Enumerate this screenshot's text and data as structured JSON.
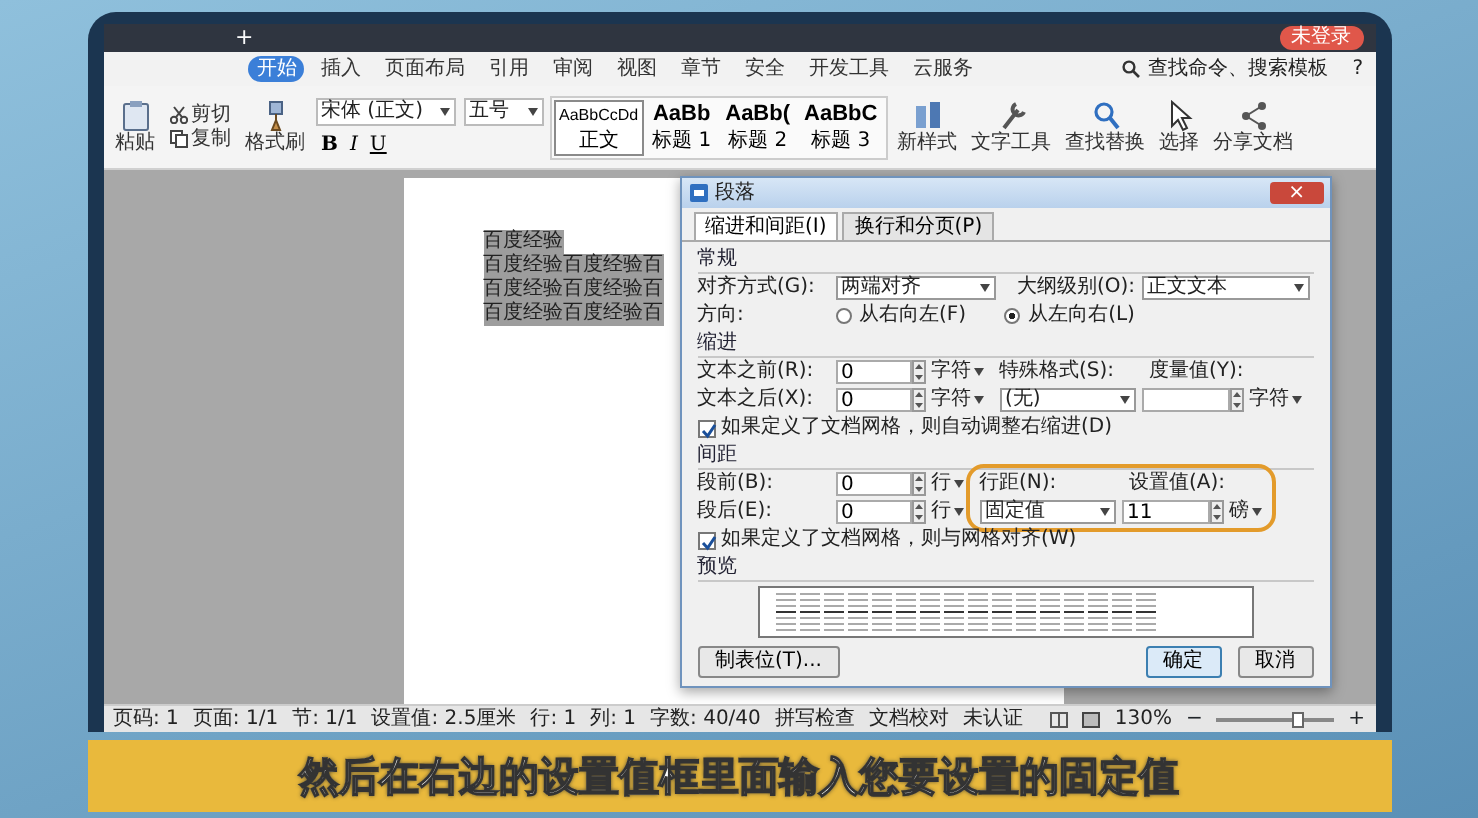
{
  "window": {
    "new_tab": "+",
    "account": "未登录"
  },
  "ribbon": {
    "tabs": [
      {
        "label": "开始",
        "selected": true
      },
      {
        "label": "插入",
        "selected": false
      },
      {
        "label": "页面布局",
        "selected": false
      },
      {
        "label": "引用",
        "selected": false
      },
      {
        "label": "审阅",
        "selected": false
      },
      {
        "label": "视图",
        "selected": false
      },
      {
        "label": "章节",
        "selected": false
      },
      {
        "label": "安全",
        "selected": false
      },
      {
        "label": "开发工具",
        "selected": false
      },
      {
        "label": "云服务",
        "selected": false
      }
    ],
    "search": "查找命令、搜索模板",
    "help": "?"
  },
  "toolbar": {
    "paste": "粘贴",
    "cut": "剪切",
    "copy": "复制",
    "format_painter": "格式刷",
    "font": "宋体 (正文)",
    "size": "五号",
    "format_buttons": [
      "B",
      "I",
      "U"
    ],
    "styles": [
      {
        "sample": "AaBbCcDd",
        "label": "正文",
        "selected": true
      },
      {
        "sample": "AaBb",
        "label": "标题 1",
        "selected": false
      },
      {
        "sample": "AaBb(",
        "label": "标题 2",
        "selected": false
      },
      {
        "sample": "AaBbC",
        "label": "标题 3",
        "selected": false
      }
    ],
    "tools": [
      {
        "label": "新样式",
        "kind": "styles"
      },
      {
        "label": "文字工具",
        "kind": "text"
      },
      {
        "label": "查找替换",
        "kind": "search"
      },
      {
        "label": "选择",
        "kind": "select"
      },
      {
        "label": "分享文档",
        "kind": "share"
      }
    ]
  },
  "document": {
    "lines": [
      "百度经验",
      "百度经验百度经验百",
      "百度经验百度经验百",
      "百度经验百度经验百"
    ]
  },
  "dialog": {
    "title": "段落",
    "close": "×",
    "tabs": [
      {
        "label": "缩进和间距(I)",
        "selected": true
      },
      {
        "label": "换行和分页(P)",
        "selected": false
      }
    ],
    "general": {
      "title": "常规",
      "alignment": {
        "label": "对齐方式(G):",
        "value": "两端对齐"
      },
      "outline": {
        "label": "大纲级别(O):",
        "value": "正文文本"
      },
      "direction": {
        "label": "方向:",
        "options": [
          {
            "label": "从右向左(F)",
            "selected": false
          },
          {
            "label": "从左向右(L)",
            "selected": true
          }
        ]
      }
    },
    "indent": {
      "title": "缩进",
      "before": {
        "label": "文本之前(R):",
        "value": "0",
        "unit": "字符"
      },
      "after": {
        "label": "文本之后(X):",
        "value": "0",
        "unit": "字符"
      },
      "special": {
        "label": "特殊格式(S):",
        "value": "(无)"
      },
      "measure": {
        "label": "度量值(Y):",
        "unit": "字符"
      },
      "auto_adjust": {
        "label": "如果定义了文档网格，则自动调整右缩进(D)",
        "checked": true
      }
    },
    "spacing": {
      "title": "间距",
      "before": {
        "label": "段前(B):",
        "value": "0",
        "unit": "行"
      },
      "after": {
        "label": "段后(E):",
        "value": "0",
        "unit": "行"
      },
      "line_spacing": {
        "label": "行距(N):",
        "value": "固定值"
      },
      "setting": {
        "label": "设置值(A):",
        "value": "11",
        "unit": "磅"
      },
      "highlighted": true,
      "snap_grid": {
        "label": "如果定义了文档网格，则与网格对齐(W)",
        "checked": true
      }
    },
    "preview": {
      "title": "预览"
    },
    "buttons": [
      {
        "label": "制表位(T)...",
        "kind": "secondary"
      },
      {
        "label": "确定",
        "kind": "primary"
      },
      {
        "label": "取消",
        "kind": "secondary"
      }
    ]
  },
  "status_bar": {
    "items": [
      "页码: 1",
      "页面: 1/1",
      "节: 1/1",
      "设置值: 2.5厘米",
      "行: 1",
      "列: 1",
      "字数: 40/40",
      "拼写检查",
      "文档校对",
      "未认证"
    ],
    "zoom": "130%",
    "zoom_out": "−",
    "zoom_in": "+",
    "zoom_slider": {
      "level": 0.7
    }
  },
  "caption": "然后在右边的设置值框里面输入您要设置的固定值"
}
